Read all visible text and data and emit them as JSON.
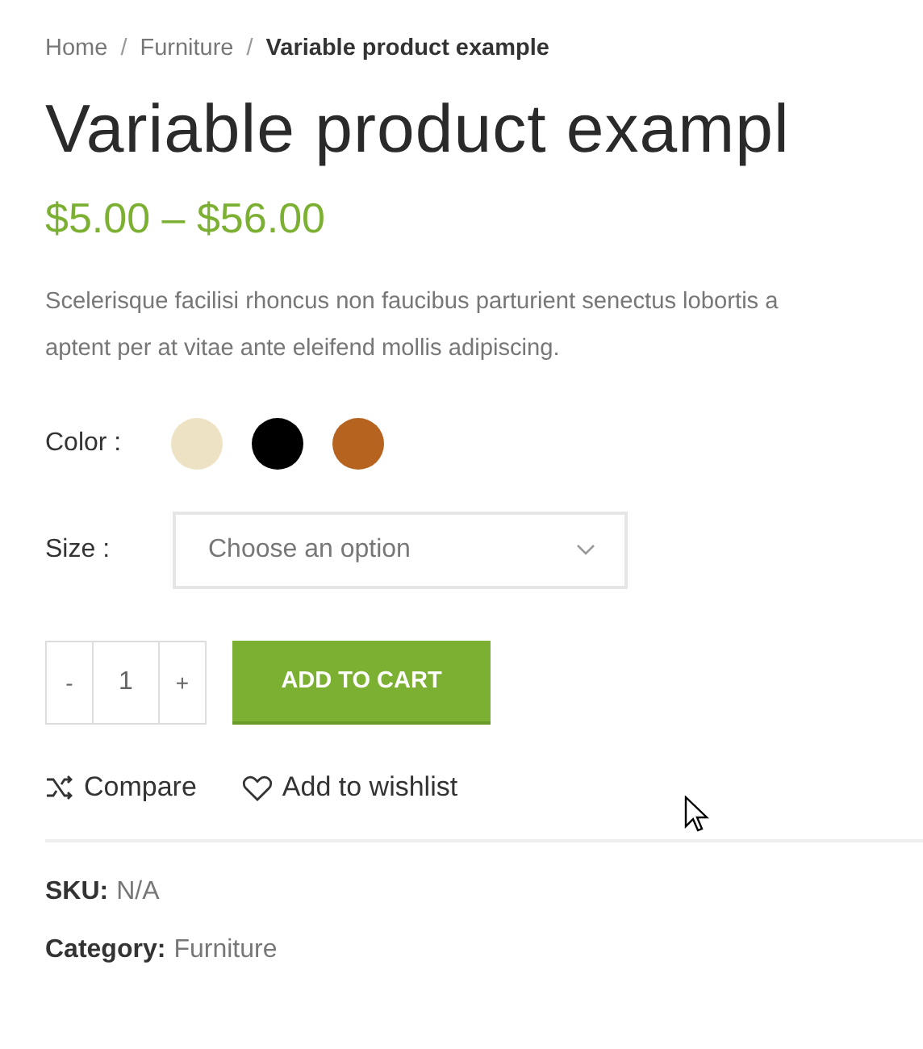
{
  "breadcrumb": [
    {
      "label": "Home",
      "current": false
    },
    {
      "label": "Furniture",
      "current": false
    },
    {
      "label": "Variable product example",
      "current": true
    }
  ],
  "breadcrumb_separator": "/",
  "title": "Variable product exampl",
  "price": "$5.00 – $56.00",
  "description_lines": [
    "Scelerisque facilisi rhoncus non faucibus parturient senectus lobortis a",
    "aptent per at vitae ante eleifend mollis adipiscing."
  ],
  "color_label": "Color :",
  "swatches": [
    {
      "color": "#ede3c4",
      "selected": false
    },
    {
      "color": "#000000",
      "selected": false
    },
    {
      "color": "#b5631f",
      "selected": false
    }
  ],
  "size_label": "Size :",
  "size_select": {
    "placeholder": "Choose an option"
  },
  "quantity": {
    "minus": "-",
    "value": "1",
    "plus": "+"
  },
  "add_to_cart": "ADD TO CART",
  "actions": [
    {
      "kind": "compare",
      "label": "Compare"
    },
    {
      "kind": "wishlist",
      "label": "Add to wishlist"
    }
  ],
  "meta": [
    {
      "label": "SKU:",
      "value": "N/A"
    },
    {
      "label": "Category:",
      "value": "Furniture"
    }
  ]
}
